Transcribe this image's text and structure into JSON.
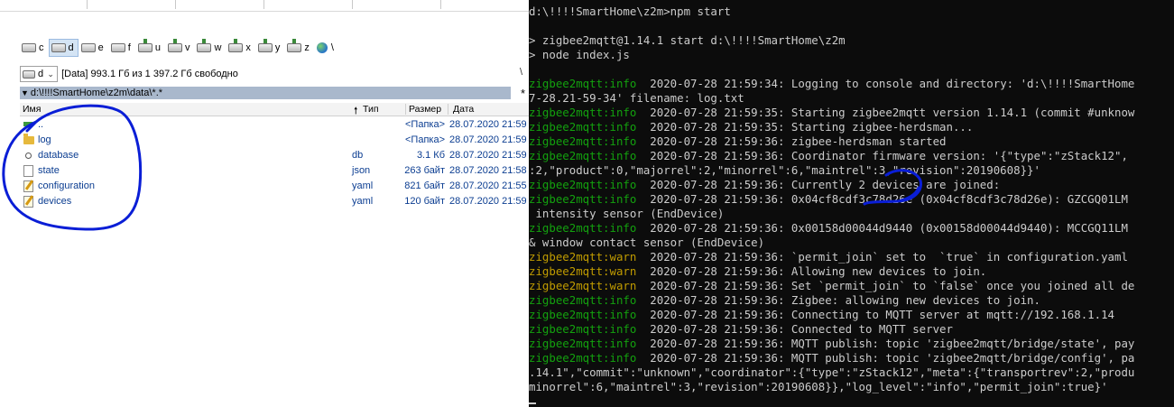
{
  "file_manager": {
    "drives": [
      {
        "letter": "c",
        "icon": "drive-icon",
        "selected": false
      },
      {
        "letter": "d",
        "icon": "drive-icon",
        "selected": true
      },
      {
        "letter": "e",
        "icon": "drive-icon",
        "selected": false
      },
      {
        "letter": "f",
        "icon": "drive-icon",
        "selected": false
      },
      {
        "letter": "u",
        "icon": "network-drive-icon",
        "selected": false
      },
      {
        "letter": "v",
        "icon": "network-drive-icon",
        "selected": false
      },
      {
        "letter": "w",
        "icon": "network-drive-icon",
        "selected": false
      },
      {
        "letter": "x",
        "icon": "network-drive-icon",
        "selected": false
      },
      {
        "letter": "y",
        "icon": "network-drive-icon",
        "selected": false
      },
      {
        "letter": "z",
        "icon": "network-drive-icon",
        "selected": false
      },
      {
        "letter": "\\",
        "icon": "globe-icon",
        "selected": false
      }
    ],
    "drive_selector": "d",
    "free_space": "[Data]  993.1 Гб из 1 397.2 Гб свободно",
    "separator_char": "\\",
    "path": "d:\\!!!!SmartHome\\z2m\\data\\*.*",
    "path_star": "*",
    "columns": {
      "name": "Имя",
      "type": "Тип",
      "size": "Размер",
      "date": "Дата"
    },
    "rows": [
      {
        "icon": "up",
        "name": "..",
        "ext": "",
        "size": "<Папка>",
        "date": "28.07.2020 21:59"
      },
      {
        "icon": "folder",
        "name": "log",
        "ext": "",
        "size": "<Папка>",
        "date": "28.07.2020 21:59"
      },
      {
        "icon": "db",
        "name": "database",
        "ext": "db",
        "size": "3.1 Кб",
        "date": "28.07.2020 21:59"
      },
      {
        "icon": "doc",
        "name": "state",
        "ext": "json",
        "size": "263 байт",
        "date": "28.07.2020 21:58"
      },
      {
        "icon": "yaml",
        "name": "configuration",
        "ext": "yaml",
        "size": "821 байт",
        "date": "28.07.2020 21:55"
      },
      {
        "icon": "yaml",
        "name": "devices",
        "ext": "yaml",
        "size": "120 байт",
        "date": "28.07.2020 21:59"
      }
    ]
  },
  "terminal": {
    "lines": [
      {
        "prefix": "",
        "text": "d:\\!!!!SmartHome\\z2m>npm start",
        "lvl": ""
      },
      {
        "prefix": "",
        "text": "",
        "lvl": ""
      },
      {
        "prefix": "",
        "text": "> zigbee2mqtt@1.14.1 start d:\\!!!!SmartHome\\z2m",
        "lvl": ""
      },
      {
        "prefix": "",
        "text": "> node index.js",
        "lvl": ""
      },
      {
        "prefix": "",
        "text": "",
        "lvl": ""
      },
      {
        "prefix": "zigbee2mqtt:info",
        "text": "  2020-07-28 21:59:34: Logging to console and directory: 'd:\\!!!!SmartHome",
        "lvl": "info"
      },
      {
        "prefix": "",
        "text": "7-28.21-59-34' filename: log.txt",
        "lvl": ""
      },
      {
        "prefix": "zigbee2mqtt:info",
        "text": "  2020-07-28 21:59:35: Starting zigbee2mqtt version 1.14.1 (commit #unknow",
        "lvl": "info"
      },
      {
        "prefix": "zigbee2mqtt:info",
        "text": "  2020-07-28 21:59:35: Starting zigbee-herdsman...",
        "lvl": "info"
      },
      {
        "prefix": "zigbee2mqtt:info",
        "text": "  2020-07-28 21:59:36: zigbee-herdsman started",
        "lvl": "info"
      },
      {
        "prefix": "zigbee2mqtt:info",
        "text": "  2020-07-28 21:59:36: Coordinator firmware version: '{\"type\":\"zStack12\",",
        "lvl": "info"
      },
      {
        "prefix": "",
        "text": ":2,\"product\":0,\"majorrel\":2,\"minorrel\":6,\"maintrel\":3,\"revision\":20190608}}'",
        "lvl": ""
      },
      {
        "prefix": "zigbee2mqtt:info",
        "text": "  2020-07-28 21:59:36: Currently 2 devices are joined:",
        "lvl": "info"
      },
      {
        "prefix": "zigbee2mqtt:info",
        "text": "  2020-07-28 21:59:36: 0x04cf8cdf3c78d26e (0x04cf8cdf3c78d26e): GZCGQ01LM",
        "lvl": "info"
      },
      {
        "prefix": "",
        "text": " intensity sensor (EndDevice)",
        "lvl": ""
      },
      {
        "prefix": "zigbee2mqtt:info",
        "text": "  2020-07-28 21:59:36: 0x00158d00044d9440 (0x00158d00044d9440): MCCGQ11LM",
        "lvl": "info"
      },
      {
        "prefix": "",
        "text": "& window contact sensor (EndDevice)",
        "lvl": ""
      },
      {
        "prefix": "zigbee2mqtt:warn",
        "text": "  2020-07-28 21:59:36: `permit_join` set to  `true` in configuration.yaml",
        "lvl": "warn"
      },
      {
        "prefix": "zigbee2mqtt:warn",
        "text": "  2020-07-28 21:59:36: Allowing new devices to join.",
        "lvl": "warn"
      },
      {
        "prefix": "zigbee2mqtt:warn",
        "text": "  2020-07-28 21:59:36: Set `permit_join` to `false` once you joined all de",
        "lvl": "warn"
      },
      {
        "prefix": "zigbee2mqtt:info",
        "text": "  2020-07-28 21:59:36: Zigbee: allowing new devices to join.",
        "lvl": "info"
      },
      {
        "prefix": "zigbee2mqtt:info",
        "text": "  2020-07-28 21:59:36: Connecting to MQTT server at mqtt://192.168.1.14",
        "lvl": "info"
      },
      {
        "prefix": "zigbee2mqtt:info",
        "text": "  2020-07-28 21:59:36: Connected to MQTT server",
        "lvl": "info"
      },
      {
        "prefix": "zigbee2mqtt:info",
        "text": "  2020-07-28 21:59:36: MQTT publish: topic 'zigbee2mqtt/bridge/state', pay",
        "lvl": "info"
      },
      {
        "prefix": "zigbee2mqtt:info",
        "text": "  2020-07-28 21:59:36: MQTT publish: topic 'zigbee2mqtt/bridge/config', pa",
        "lvl": "info"
      },
      {
        "prefix": "",
        "text": ".14.1\",\"commit\":\"unknown\",\"coordinator\":{\"type\":\"zStack12\",\"meta\":{\"transportrev\":2,\"produ",
        "lvl": ""
      },
      {
        "prefix": "",
        "text": "minorrel\":6,\"maintrel\":3,\"revision\":20190608}},\"log_level\":\"info\",\"permit_join\":true}'",
        "lvl": ""
      }
    ]
  },
  "colors": {
    "terminal_bg": "#0c0c0c",
    "terminal_fg": "#cccccc",
    "info": "#13a10e",
    "warn": "#c19c00",
    "annotation": "#0a1ed6",
    "path_bar": "#a9b8cc",
    "file_text": "#0b3d91"
  }
}
